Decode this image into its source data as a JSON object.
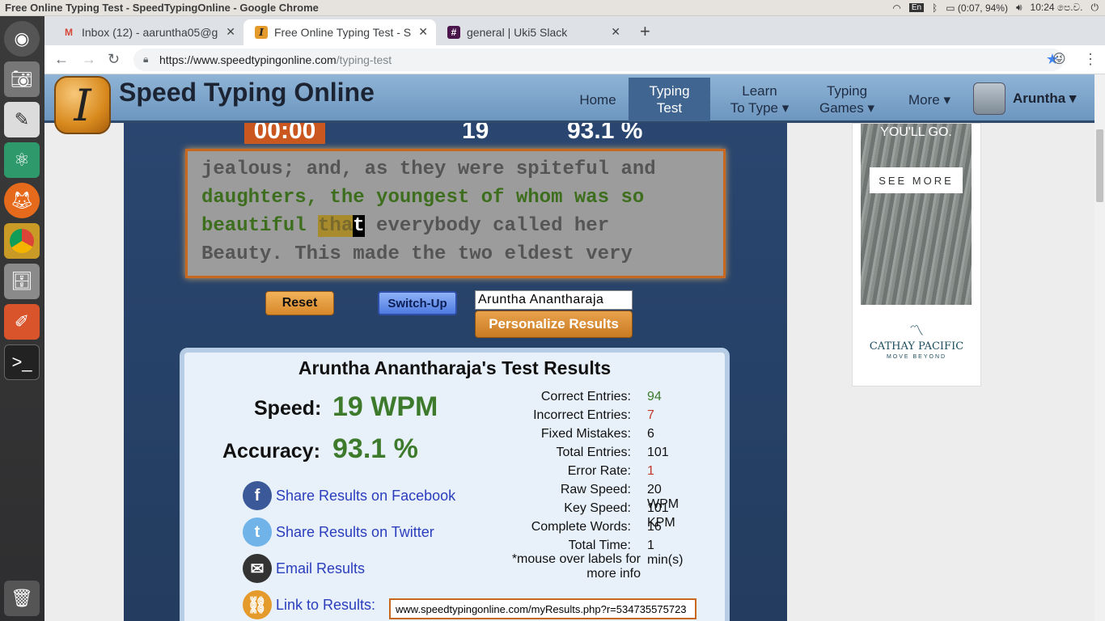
{
  "system_bar": {
    "window_title": "Free Online Typing Test - SpeedTypingOnline - Google Chrome",
    "battery": "(0:07, 94%)",
    "time": "10:24 පෙ.ව.",
    "keyboard": "En"
  },
  "launcher": {
    "items": [
      "dash-icon",
      "camera-icon",
      "text-editor-icon",
      "atom-icon",
      "firefox-icon",
      "chrome-icon",
      "files-icon",
      "paint-icon",
      "terminal-icon",
      "trash-icon"
    ]
  },
  "tabs": [
    {
      "title": "Inbox (12) - aaruntha05@g",
      "icon": "M"
    },
    {
      "title": "Free Online Typing Test - S",
      "icon": "I"
    },
    {
      "title": "general | Uki5 Slack",
      "icon": "#"
    }
  ],
  "address": {
    "host": "https://www.speedtypingonline.com",
    "path": "/typing-test"
  },
  "site": {
    "name": "Speed Typing Online",
    "logo_letter": "I",
    "nav": {
      "home": "Home",
      "typing_test_1": "Typing",
      "typing_test_2": "Test",
      "learn_1": "Learn",
      "learn_2": "To Type ▾",
      "games_1": "Typing",
      "games_2": "Games ▾",
      "more": "More ▾"
    },
    "user": "Aruntha ▾"
  },
  "test": {
    "timer": "00:00",
    "wpm": "19",
    "accuracy": "93.1 %",
    "lines": [
      {
        "done": "",
        "rest": "jealous; and, as they were spiteful and"
      },
      {
        "done": "daughters, the youngest of whom was so",
        "rest": ""
      }
    ],
    "line3_done": "beautiful ",
    "line3_cur": "tha",
    "line3_caret": "t",
    "line3_rest": " everybody called her",
    "line4": "Beauty. This made the two eldest very",
    "reset_label": "Reset",
    "switch_label": "Switch-Up",
    "name_value": "Aruntha Anantharaja",
    "personalize_label": "Personalize Results"
  },
  "results": {
    "title": "Aruntha Anantharaja's Test Results",
    "speed_label": "Speed:",
    "speed_value": "19 WPM",
    "accuracy_label": "Accuracy:",
    "accuracy_value": "93.1 %",
    "stats": [
      {
        "label": "Correct Entries:",
        "value": "94",
        "color": "#3d7a2b"
      },
      {
        "label": "Incorrect Entries:",
        "value": "7",
        "color": "#c0392b"
      },
      {
        "label": "Fixed Mistakes:",
        "value": "6",
        "color": "#111111"
      },
      {
        "label": "Total Entries:",
        "value": "101",
        "color": "#111111"
      },
      {
        "label": "Error Rate:",
        "value": "1",
        "color": "#c0392b"
      },
      {
        "label": "Raw Speed:",
        "value": "20 WPM",
        "color": "#111111"
      },
      {
        "label": "Key Speed:",
        "value": "101 KPM",
        "color": "#111111"
      },
      {
        "label": "Complete Words:",
        "value": "16",
        "color": "#111111"
      },
      {
        "label": "Total Time:",
        "value": "1 min(s)",
        "color": "#111111"
      }
    ],
    "note_1": "*mouse over labels for",
    "note_2": "more info",
    "share_facebook": "Share Results on Facebook",
    "share_twitter": "Share Results on Twitter",
    "email": "Email Results",
    "link_label": "Link to Results:",
    "link_url": "www.speedtypingonline.com/myResults.php?r=534735575723"
  },
  "ad": {
    "headline": "YOU'LL GO.",
    "button": "SEE MORE",
    "brand": "CATHAY PACIFIC",
    "tagline": "MOVE BEYOND"
  }
}
